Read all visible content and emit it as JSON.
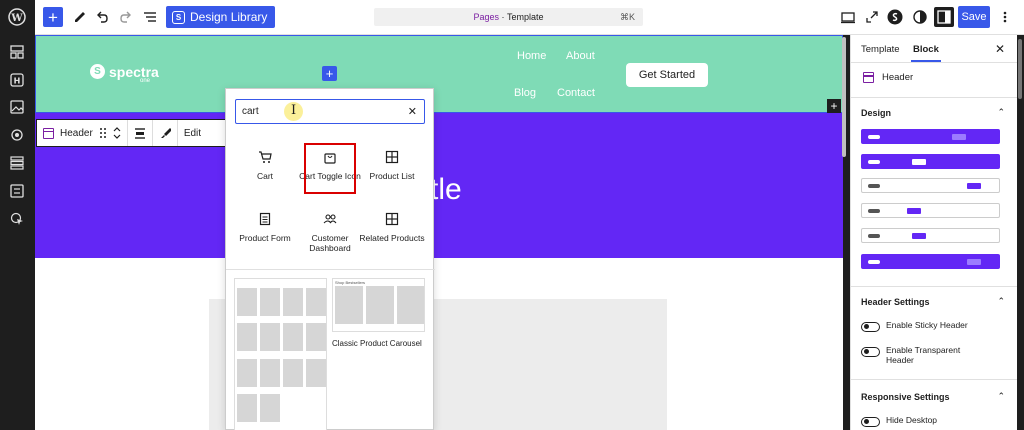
{
  "topbar": {
    "design_library_label": "Design Library",
    "doc_pages": "Pages",
    "doc_sep": " · ",
    "doc_title": "Template",
    "shortcut": "⌘K",
    "save_label": "Save"
  },
  "canvas": {
    "logo_word": "spectra",
    "logo_sub": "one",
    "nav": [
      "Home",
      "About",
      "Blog",
      "Contact"
    ],
    "cta": "Get Started",
    "hero_title_partial": "tle"
  },
  "block_toolbar": {
    "block_name": "Header",
    "edit": "Edit"
  },
  "inserter": {
    "search_value": "cart",
    "blocks": [
      "Cart",
      "Cart Toggle Icon",
      "Product List",
      "Product Form",
      "Customer Dashboard",
      "Related Products"
    ],
    "pattern_heading": "Shop Bestsellers",
    "pattern_title": "Classic Product Carousel"
  },
  "sidebar": {
    "tab_template": "Template",
    "tab_block": "Block",
    "block_name": "Header",
    "design_title": "Design",
    "header_settings_title": "Header Settings",
    "sticky_label": "Enable Sticky Header",
    "transparent_label": "Enable Transparent Header",
    "responsive_title": "Responsive Settings",
    "hide_desktop_label": "Hide Desktop"
  },
  "colors": {
    "accent": "#3858e9",
    "header_bg": "#7fdbb6",
    "hero_bg": "#6327f5",
    "highlight": "#d90000"
  }
}
